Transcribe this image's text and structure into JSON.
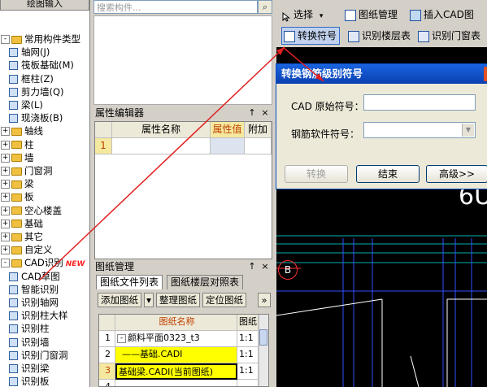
{
  "left_top_label": "绘图输入",
  "tree": [
    {
      "label": "常用构件类型",
      "level": 0,
      "type": "folder",
      "toggle": "-"
    },
    {
      "label": "轴网(J)",
      "level": 1,
      "type": "item",
      "color": "#3060a0"
    },
    {
      "label": "筏板基础(M)",
      "level": 1,
      "type": "item",
      "color": "#3060a0"
    },
    {
      "label": "框柱(Z)",
      "level": 1,
      "type": "item",
      "color": "#3060a0"
    },
    {
      "label": "剪力墙(Q)",
      "level": 1,
      "type": "item",
      "color": "#3060a0"
    },
    {
      "label": "梁(L)",
      "level": 1,
      "type": "item",
      "color": "#3060a0"
    },
    {
      "label": "现浇板(B)",
      "level": 1,
      "type": "item",
      "color": "#3060a0"
    },
    {
      "label": "轴线",
      "level": 0,
      "type": "folder",
      "toggle": "+"
    },
    {
      "label": "柱",
      "level": 0,
      "type": "folder",
      "toggle": "+"
    },
    {
      "label": "墙",
      "level": 0,
      "type": "folder",
      "toggle": "+"
    },
    {
      "label": "门窗洞",
      "level": 0,
      "type": "folder",
      "toggle": "+"
    },
    {
      "label": "梁",
      "level": 0,
      "type": "folder",
      "toggle": "+"
    },
    {
      "label": "板",
      "level": 0,
      "type": "folder",
      "toggle": "+"
    },
    {
      "label": "空心楼盖",
      "level": 0,
      "type": "folder",
      "toggle": "+"
    },
    {
      "label": "基础",
      "level": 0,
      "type": "folder",
      "toggle": "+"
    },
    {
      "label": "其它",
      "level": 0,
      "type": "folder",
      "toggle": "+"
    },
    {
      "label": "自定义",
      "level": 0,
      "type": "folder",
      "toggle": "+"
    },
    {
      "label": "CAD识别",
      "level": 0,
      "type": "folder",
      "toggle": "-",
      "badge": "NEW"
    },
    {
      "label": "CAD草图",
      "level": 1,
      "type": "item",
      "color": "#3060a0"
    },
    {
      "label": "智能识别",
      "level": 1,
      "type": "item",
      "color": "#3060a0"
    },
    {
      "label": "识别轴网",
      "level": 1,
      "type": "item",
      "color": "#3060a0"
    },
    {
      "label": "识别柱大样",
      "level": 1,
      "type": "item",
      "color": "#3060a0"
    },
    {
      "label": "识别柱",
      "level": 1,
      "type": "item",
      "color": "#3060a0"
    },
    {
      "label": "识别墙",
      "level": 1,
      "type": "item",
      "color": "#3060a0"
    },
    {
      "label": "识别门窗洞",
      "level": 1,
      "type": "item",
      "color": "#3060a0"
    },
    {
      "label": "识别梁",
      "level": 1,
      "type": "item",
      "color": "#3060a0"
    },
    {
      "label": "识别板",
      "level": 1,
      "type": "item",
      "color": "#3060a0"
    }
  ],
  "search": {
    "placeholder": "搜索构件...",
    "icon": "search-icon"
  },
  "prop_panel": {
    "title": "属性编辑器",
    "pin": "↑",
    "close": "×",
    "columns": [
      "属性名称",
      "属性值",
      "附加"
    ],
    "row_num": "1"
  },
  "drawings_panel": {
    "title": "图纸管理",
    "pin": "↑",
    "close": "×",
    "tabs": [
      "图纸文件列表",
      "图纸楼层对照表"
    ],
    "buttons": [
      "添加图纸",
      "整理图纸",
      "定位图纸"
    ],
    "more": "»",
    "dropdown": "▾",
    "columns": [
      "图纸名称",
      "图纸"
    ],
    "rows": [
      {
        "num": "1",
        "toggle": "-",
        "name": "颜料平面0323_t3",
        "scale": "1:1"
      },
      {
        "num": "2",
        "toggle": "",
        "name": "基础.CADI",
        "scale": "1:1"
      },
      {
        "num": "3",
        "toggle": "",
        "name": "基础梁.CADI(当前图纸)",
        "scale": "1:1"
      },
      {
        "num": "4",
        "toggle": "",
        "name": "",
        "scale": ""
      }
    ]
  },
  "toolbar1": {
    "select": "选择",
    "select_caret": "▾",
    "drawing_mgmt": "图纸管理",
    "insert_cad": "插入CAD图"
  },
  "toolbar2": {
    "convert": "转换符号",
    "recognize_layer": "识别楼层表",
    "recognize_door": "识别门窗表"
  },
  "canvas": {
    "text": "6U",
    "axis_label": "B"
  },
  "dialog": {
    "title": "转换钢筋级别符号",
    "cad_label": "CAD 原始符号：",
    "rebar_label": "钢筋软件符号：",
    "cad_value": "",
    "rebar_value": "",
    "btn_convert": "转换",
    "btn_end": "结束",
    "btn_advanced": "高级>>"
  },
  "colors": {
    "annotation": "#e02020",
    "dialog_title": "#1a64e0",
    "highlight": "#ffff00"
  }
}
